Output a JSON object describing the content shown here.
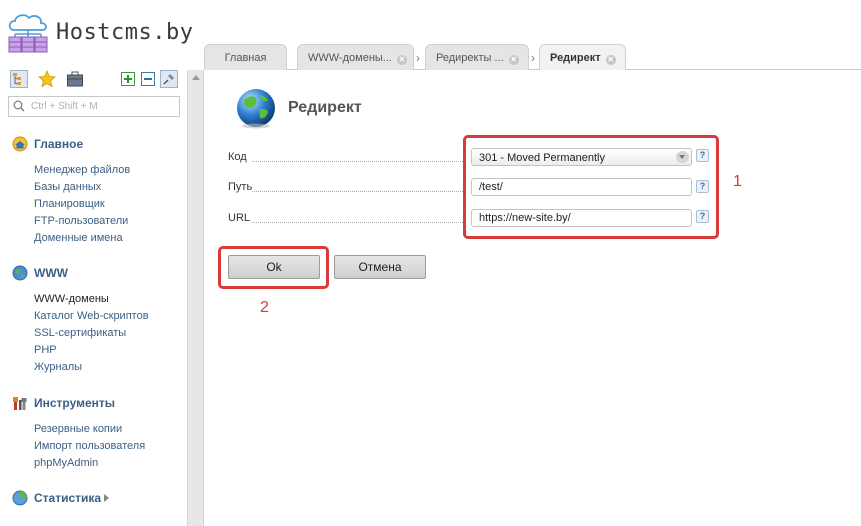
{
  "brand": {
    "name": "Hostcms.by"
  },
  "tabs": [
    {
      "label": "Главная"
    },
    {
      "label": "WWW-домены..."
    },
    {
      "label": "Редиректы ..."
    },
    {
      "label": "Редирект"
    }
  ],
  "tab_separator": "›",
  "sidebar": {
    "search_placeholder": "Ctrl + Shift + M",
    "sections": [
      {
        "title": "Главное",
        "icon": "home-icon",
        "items": [
          "Менеджер файлов",
          "Базы данных",
          "Планировщик",
          "FTP-пользователи",
          "Доменные имена"
        ]
      },
      {
        "title": "WWW",
        "icon": "globe-icon",
        "items": [
          "WWW-домены",
          "Каталог Web-скриптов",
          "SSL-сертификаты",
          "PHP",
          "Журналы"
        ],
        "current": "WWW-домены"
      },
      {
        "title": "Инструменты",
        "icon": "tools-icon",
        "items": [
          "Резервные копии",
          "Импорт пользователя",
          "phpMyAdmin"
        ]
      },
      {
        "title": "Статистика",
        "icon": "stats-icon",
        "items": []
      }
    ]
  },
  "form": {
    "title": "Редирект",
    "fields": {
      "code": {
        "label": "Код",
        "value": "301 - Moved Permanently"
      },
      "path": {
        "label": "Путь",
        "value": "/test/"
      },
      "url": {
        "label": "URL",
        "value": "https://new-site.by/"
      }
    },
    "help_symbol": "?",
    "ok_label": "Ok",
    "cancel_label": "Отмена"
  },
  "annotations": {
    "fields_number": "1",
    "ok_number": "2",
    "color": "#d93a3a"
  }
}
